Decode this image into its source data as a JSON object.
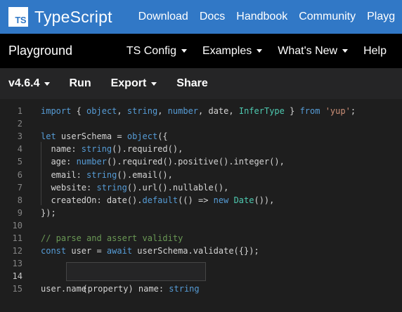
{
  "header": {
    "logo_text": "TS",
    "brand": "TypeScript",
    "links": [
      "Download",
      "Docs",
      "Handbook",
      "Community",
      "Playg"
    ]
  },
  "subheader": {
    "title": "Playground",
    "menus": [
      "TS Config",
      "Examples",
      "What's New",
      "Help"
    ]
  },
  "toolbar": {
    "version": "v4.6.4",
    "run": "Run",
    "export": "Export",
    "share": "Share"
  },
  "editor": {
    "active_line": 14,
    "lines": [
      {
        "n": "1",
        "tokens": [
          [
            "import",
            "kw"
          ],
          [
            " { ",
            "p"
          ],
          [
            "object",
            "fn"
          ],
          [
            ", ",
            "p"
          ],
          [
            "string",
            "fn"
          ],
          [
            ", ",
            "p"
          ],
          [
            "number",
            "fn"
          ],
          [
            ", ",
            "p"
          ],
          [
            "date",
            "p"
          ],
          [
            ", ",
            "p"
          ],
          [
            "InferType",
            "type"
          ],
          [
            " } ",
            "p"
          ],
          [
            "from",
            "kw"
          ],
          [
            " ",
            "p"
          ],
          [
            "'yup'",
            "str"
          ],
          [
            ";",
            "p"
          ]
        ]
      },
      {
        "n": "2",
        "tokens": []
      },
      {
        "n": "3",
        "tokens": [
          [
            "let",
            "kw"
          ],
          [
            " userSchema = ",
            "p"
          ],
          [
            "object",
            "fn"
          ],
          [
            "({",
            "p"
          ]
        ]
      },
      {
        "n": "4",
        "tokens": [
          [
            "  name: ",
            "p"
          ],
          [
            "string",
            "fn"
          ],
          [
            "().required(),",
            "p"
          ]
        ]
      },
      {
        "n": "5",
        "tokens": [
          [
            "  age: ",
            "p"
          ],
          [
            "number",
            "fn"
          ],
          [
            "().required().positive().integer(),",
            "p"
          ]
        ]
      },
      {
        "n": "6",
        "tokens": [
          [
            "  email: ",
            "p"
          ],
          [
            "string",
            "fn"
          ],
          [
            "().email(),",
            "p"
          ]
        ]
      },
      {
        "n": "7",
        "tokens": [
          [
            "  website: ",
            "p"
          ],
          [
            "string",
            "fn"
          ],
          [
            "().url().nullable(),",
            "p"
          ]
        ]
      },
      {
        "n": "8",
        "tokens": [
          [
            "  createdOn: date().",
            "p"
          ],
          [
            "default",
            "kw"
          ],
          [
            "(() => ",
            "p"
          ],
          [
            "new",
            "kw"
          ],
          [
            " ",
            "p"
          ],
          [
            "Date",
            "type"
          ],
          [
            "()),",
            "p"
          ]
        ]
      },
      {
        "n": "9",
        "tokens": [
          [
            "});",
            "p"
          ]
        ]
      },
      {
        "n": "10",
        "tokens": []
      },
      {
        "n": "11",
        "tokens": [
          [
            "// parse and assert validity",
            "comment"
          ]
        ]
      },
      {
        "n": "12",
        "tokens": [
          [
            "const",
            "kw"
          ],
          [
            " user = ",
            "p"
          ],
          [
            "await",
            "kw"
          ],
          [
            " userSchema.validate({});",
            "p"
          ]
        ]
      },
      {
        "n": "13",
        "tokens": []
      },
      {
        "n": "14",
        "tokens": []
      },
      {
        "n": "15",
        "tokens": [
          [
            "user.name",
            "p"
          ]
        ]
      }
    ]
  },
  "hover_tooltip": {
    "prefix": "(property) name: ",
    "type": "string"
  },
  "colors": {
    "brand_blue": "#3178c6",
    "keyword": "#569cd6",
    "function": "#569cd6",
    "type": "#4ec9b0",
    "string": "#ce9178",
    "comment": "#6a9955",
    "plain": "#d4d4d4"
  }
}
